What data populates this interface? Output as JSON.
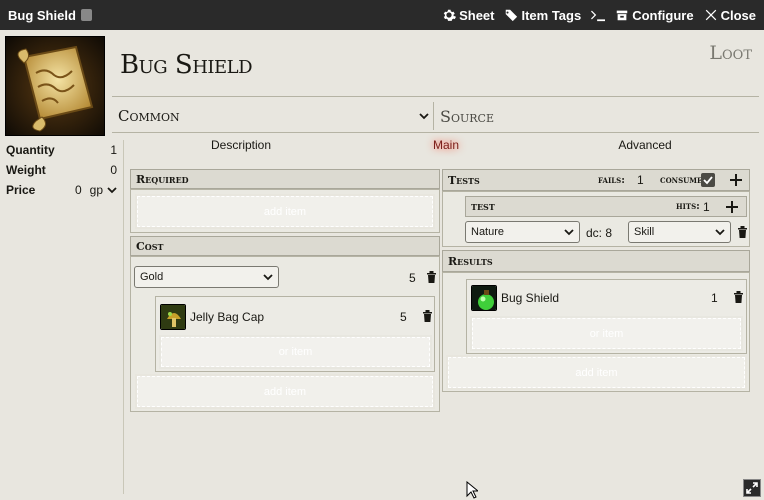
{
  "window": {
    "title": "Bug Shield",
    "controls": {
      "sheet": "Sheet",
      "item_tags": "Item Tags",
      "console": "",
      "configure": "Configure",
      "close": "Close"
    }
  },
  "header": {
    "name": "Bug Shield",
    "type": "Loot",
    "rarity": "Common",
    "source_placeholder": "Source"
  },
  "properties": {
    "quantity_label": "Quantity",
    "quantity_value": "1",
    "weight_label": "Weight",
    "weight_value": "0",
    "price_label": "Price",
    "price_value": "0",
    "price_unit": "gp"
  },
  "tabs": {
    "description": "Description",
    "main": "Main",
    "advanced": "Advanced"
  },
  "required": {
    "heading": "Required",
    "add_item": "add item"
  },
  "cost": {
    "heading": "Cost",
    "currency": "Gold",
    "amount": "5",
    "item_name": "Jelly Bag Cap",
    "item_qty": "5",
    "or_item": "or item",
    "add_item": "add item"
  },
  "tests": {
    "heading": "Tests",
    "fails_label": "fails:",
    "fails_value": "1",
    "consume_label": "consume:",
    "test_heading": "test",
    "hits_label": "hits:",
    "hits_value": "1",
    "skill_select": "Nature",
    "dc_label": "dc: 8",
    "type_select": "Skill"
  },
  "results": {
    "heading": "Results",
    "item_name": "Bug Shield",
    "item_qty": "1",
    "or_item": "or item",
    "add_item": "add item"
  },
  "colors": {
    "accent_active_tab": "#7a1d18",
    "titlebar": "#2a2a2a",
    "background": "#e8e6df"
  }
}
